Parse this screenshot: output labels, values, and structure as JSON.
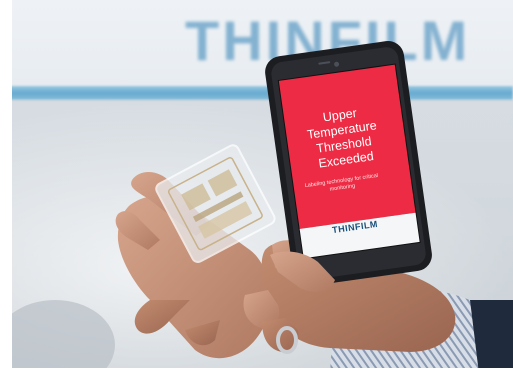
{
  "photo": {
    "wall_sign_text": "THINFILM",
    "phone_screen": {
      "alert_title": "Upper Temperature Threshold Exceeded",
      "alert_subtitle": "Labeling technology for critical monitoring",
      "brand_logo": "THINFILM"
    },
    "colors": {
      "screen_red": "#ee2b44",
      "wall_stripe": "#3c95c6",
      "sign_blue": "#2f7fb4",
      "phone_body": "#1c1d21"
    }
  }
}
